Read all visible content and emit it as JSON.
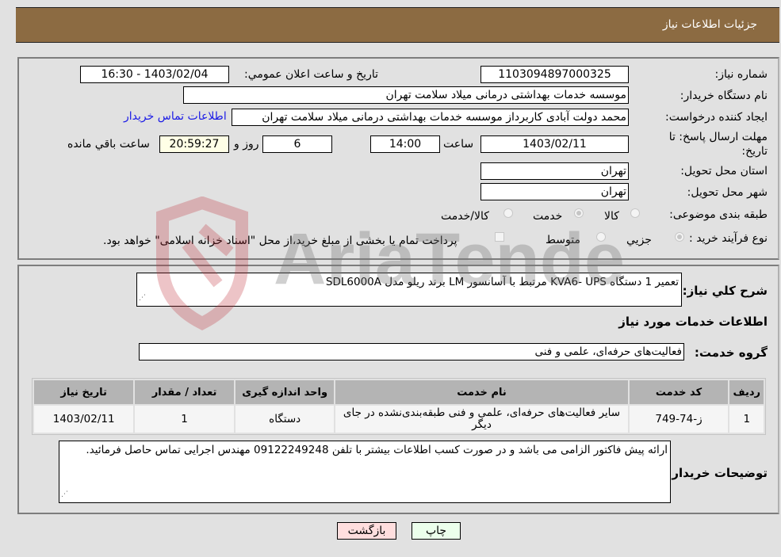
{
  "header": {
    "title": "جزئیات اطلاعات نیاز"
  },
  "details": {
    "need_number": {
      "label": "شماره نیاز:",
      "value": "1103094897000325"
    },
    "announce_datetime": {
      "label": "تاریخ و ساعت اعلان عمومي:",
      "value": "1403/02/04 - 16:30"
    },
    "buyer_org": {
      "label": "نام دستگاه خريدار:",
      "value": "موسسه خدمات بهداشتی درمانی میلاد سلامت تهران"
    },
    "requester": {
      "label": "ايجاد کننده درخواست:",
      "value": "محمد دولت آبادی کاربرداز موسسه خدمات بهداشتی درمانی میلاد سلامت تهران",
      "contact_link": "اطلاعات تماس خريدار"
    },
    "deadline": {
      "label": "مهلت ارسال پاسخ: تا تاریخ:",
      "date": "1403/02/11",
      "time_label": "ساعت",
      "time": "14:00",
      "days": "6",
      "days_label": "روز و",
      "remaining": "20:59:27",
      "remaining_label": "ساعت باقي مانده"
    },
    "province": {
      "label": "استان محل تحويل:",
      "value": "تهران"
    },
    "city": {
      "label": "شهر محل تحويل:",
      "value": "تهران"
    },
    "category": {
      "label": "طبقه بندی موضوعی:",
      "options": [
        {
          "label": "کالا",
          "selected": false
        },
        {
          "label": "خدمت",
          "selected": true
        },
        {
          "label": "کالا/خدمت",
          "selected": false
        }
      ]
    },
    "purchase_type": {
      "label": "نوع فرآيند خريد :",
      "options": [
        {
          "label": "جزيي",
          "selected": true
        },
        {
          "label": "متوسط",
          "selected": false
        }
      ],
      "treasury_checkbox": {
        "label": "پرداخت تمام يا بخشی از مبلغ خريد،از محل \"اسناد خزانه اسلامی\" خواهد بود.",
        "checked": false
      }
    }
  },
  "summary": {
    "label": "شرح کلي نياز:",
    "value": "تعمیر 1 دستگاه  KVA6- UPS مرتبط با آسانسور LM برند ریلو مدل  SDL6000A"
  },
  "services": {
    "section_title": "اطلاعات خدمات مورد نياز",
    "group_label": "گروه خدمت:",
    "group_value": "فعالیت‌های حرفه‌ای، علمی و فنی",
    "table": {
      "columns": [
        "رديف",
        "کد خدمت",
        "نام خدمت",
        "واحد اندازه گيری",
        "تعداد / مقدار",
        "تاريخ نياز"
      ],
      "rows": [
        [
          "1",
          "ز-74-749",
          "سایر فعالیت‌های حرفه‌ای، علمی و فنی طبقه‌بندی‌نشده در جای دیگر",
          "دستگاه",
          "1",
          "1403/02/11"
        ]
      ]
    }
  },
  "buyer_notes": {
    "label": "توضيحات خريدار:",
    "value": "ارائه پیش فاکتور الزامی می باشد و در صورت کسب اطلاعات بیشتر با تلفن 09122249248 مهندس اجرایی تماس حاصل فرمائید."
  },
  "buttons": {
    "print": "چاپ",
    "back": "بازگشت"
  },
  "watermark": {
    "text": "AriaTender.neT"
  },
  "colors": {
    "header_bg": "#8c6b42",
    "page_bg": "#e1e1e1",
    "link": "#1a1ae6",
    "print_bg": "#ecffec",
    "back_bg": "#ffdede",
    "remaining_bg": "#ffffe6"
  }
}
